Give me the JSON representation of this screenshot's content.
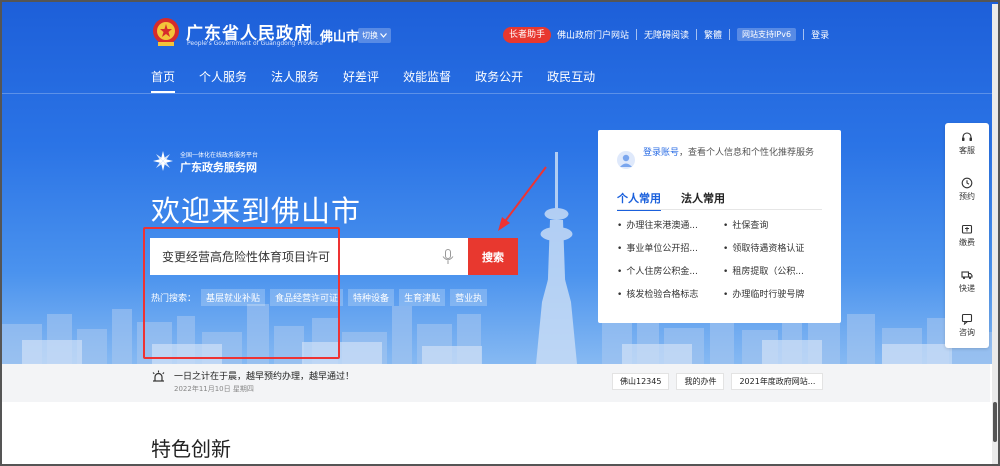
{
  "header": {
    "site_title": "广东省人民政府",
    "site_subtitle": "People's Government of Guangdong Province",
    "city": "佛山市",
    "switch_label": "切换",
    "elder_helper": "长者助手",
    "links": [
      "佛山政府门户网站",
      "无障碍阅读",
      "繁體"
    ],
    "ipv6_badge": "网站支持IPv6",
    "login": "登录"
  },
  "nav": {
    "items": [
      "首页",
      "个人服务",
      "法人服务",
      "好差评",
      "效能监督",
      "政务公开",
      "政民互动"
    ],
    "active_index": 0
  },
  "brand": {
    "small_text": "全国一体化在线政务服务平台",
    "name": "广东政务服务网"
  },
  "hero": {
    "welcome": "欢迎来到佛山市"
  },
  "search": {
    "value": "变更经营高危险性体育项目许可",
    "button": "搜索",
    "hot_label": "热门搜索：",
    "hot_tags": [
      "基层就业补贴",
      "食品经营许可证",
      "特种设备",
      "生育津贴",
      "营业执"
    ]
  },
  "card": {
    "login_link": "登录账号",
    "prompt": "，查看个人信息和个性化推荐服务",
    "tabs": [
      "个人常用",
      "法人常用"
    ],
    "services": [
      "办理往来港澳通...",
      "社保查询",
      "事业单位公开招...",
      "领取待遇资格认证",
      "个人住房公积金...",
      "租房提取（公积...",
      "核发检验合格标志",
      "办理临时行驶号牌"
    ]
  },
  "side": {
    "items": [
      {
        "label": "客服",
        "icon": "headset-icon"
      },
      {
        "label": "预约",
        "icon": "clock-icon"
      },
      {
        "label": "缴费",
        "icon": "wallet-icon"
      },
      {
        "label": "快递",
        "icon": "truck-icon"
      },
      {
        "label": "咨询",
        "icon": "chat-icon"
      }
    ]
  },
  "notice": {
    "text": "一日之计在于晨，越早预约办理，越早通过！",
    "date": "2022年11月10日 星期四",
    "quick_links": [
      "佛山12345",
      "我的办件",
      "2021年度政府网站..."
    ]
  },
  "section": {
    "title": "特色创新"
  },
  "colors": {
    "primary": "#2b6de5",
    "accent_red": "#e8382f"
  }
}
